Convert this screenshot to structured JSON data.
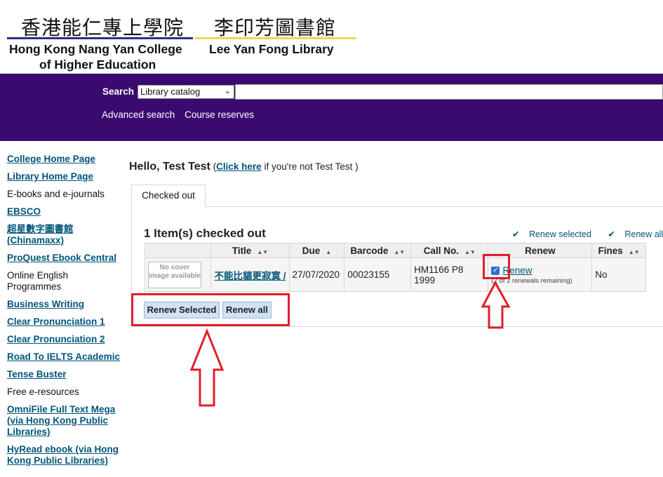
{
  "header": {
    "college_zh": "香港能仁專上學院",
    "college_en_line1": "Hong Kong Nang Yan College",
    "college_en_line2": "of Higher Education",
    "library_zh": "李印芳圖書館",
    "library_en": "Lee Yan Fong Library",
    "colors": {
      "college_bar": "#2a2f8c",
      "library_bar": "#f2d64b",
      "band": "#3a0a6e"
    }
  },
  "search": {
    "label": "Search",
    "selected_option": "Library catalog",
    "links": [
      "Advanced search",
      "Course reserves"
    ]
  },
  "sidebar": {
    "items": [
      {
        "label": "College Home Page",
        "type": "link"
      },
      {
        "label": "Library Home Page",
        "type": "link"
      },
      {
        "label": "E-books and e-journals",
        "type": "header"
      },
      {
        "label": "EBSCO",
        "type": "link"
      },
      {
        "label": "超星數字圖書館 (Chinamaxx)",
        "type": "link"
      },
      {
        "label": "ProQuest Ebook Central",
        "type": "link"
      },
      {
        "label": "Online English Programmes",
        "type": "header"
      },
      {
        "label": "Business Writing",
        "type": "link"
      },
      {
        "label": "Clear Pronunciation 1",
        "type": "link"
      },
      {
        "label": "Clear Pronunciation 2",
        "type": "link"
      },
      {
        "label": "Road To IELTS Academic",
        "type": "link"
      },
      {
        "label": "Tense Buster",
        "type": "link"
      },
      {
        "label": "Free e-resources",
        "type": "header"
      },
      {
        "label": "OmniFile Full Text Mega (via Hong Kong Public Libraries)",
        "type": "link"
      },
      {
        "label": "HyRead ebook (via Hong Kong Public Libraries)",
        "type": "link"
      }
    ]
  },
  "main": {
    "greeting_prefix": "Hello, ",
    "user_name": "Test Test",
    "greeting_open": " (",
    "click_here": "Click here",
    "greeting_suffix": " if you're not Test Test )",
    "tab_label": "Checked out",
    "checked_out_title": "1 Item(s) checked out",
    "renew_selected_link": "Renew selected",
    "renew_all_link": "Renew all",
    "table": {
      "headers": [
        "",
        "Title",
        "Due",
        "Barcode",
        "Call No.",
        "Renew",
        "Fines"
      ],
      "rows": [
        {
          "cover": "No cover image available",
          "title": "不能比貓更寂寞 /",
          "due": "27/07/2020",
          "barcode": "00023155",
          "call_no": "HM1166 P8 1999",
          "renew_label": "Renew",
          "renew_checked": true,
          "renewals_remaining": "(2 of 2 renewals remaining)",
          "fines": "No"
        }
      ]
    },
    "buttons": {
      "renew_selected": "Renew Selected",
      "renew_all": "Renew all"
    }
  },
  "annotation_color": "#e01e2a"
}
